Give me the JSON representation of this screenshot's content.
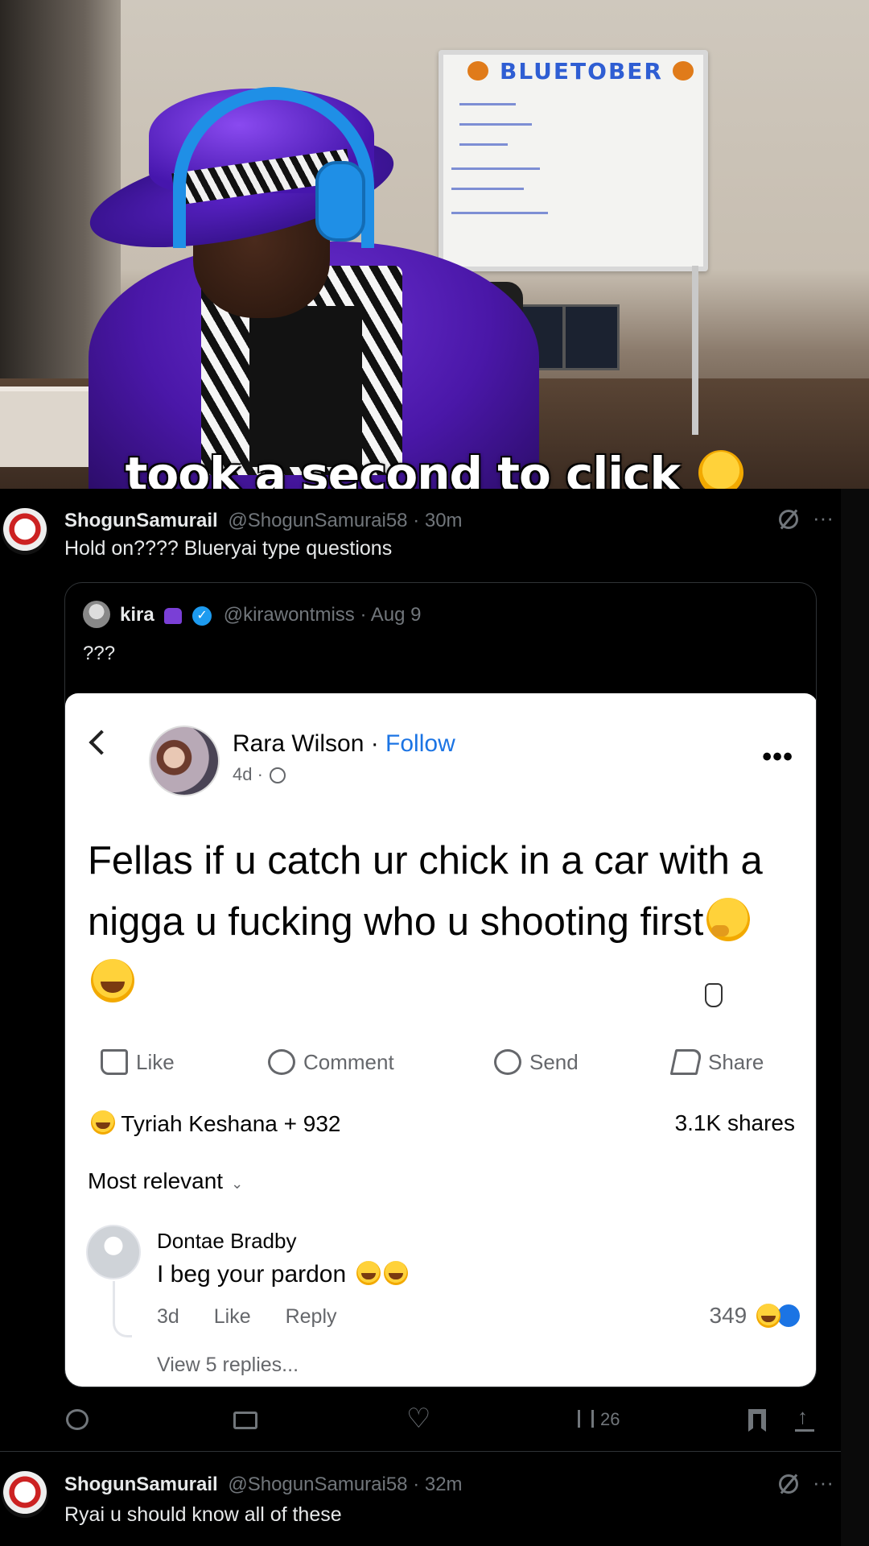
{
  "stream": {
    "caption": "took a second to click",
    "caption_emoji": "loudly-crying-face",
    "whiteboard_title": "BLUETOBER"
  },
  "tweet1": {
    "name": "ShogunSamurail",
    "handle": "@ShogunSamurai58",
    "time": "30m",
    "text": "Hold on???? Blueryai type questions",
    "more": "···"
  },
  "quote": {
    "name": "kira",
    "handle": "@kirawontmiss",
    "date": "Aug 9",
    "text": "???"
  },
  "fb": {
    "author": "Rara Wilson",
    "separator": " · ",
    "follow": "Follow",
    "time": "4d ·",
    "more": "•••",
    "post_text": "Fellas if u catch ur chick in a car with a nigga u fucking who u shooting first",
    "actions": {
      "like": "Like",
      "comment": "Comment",
      "send": "Send",
      "share": "Share"
    },
    "reactions": "Tyriah Keshana + 932",
    "shares": "3.1K shares",
    "sort": "Most relevant",
    "comment": {
      "name": "Dontae Bradby",
      "text": "I beg your pardon",
      "time": "3d",
      "like": "Like",
      "reply": "Reply",
      "count": "349",
      "view_replies": "View 5 replies..."
    }
  },
  "tweet_actions": {
    "views": "26"
  },
  "tweet2": {
    "name": "ShogunSamurail",
    "handle": "@ShogunSamurai58",
    "time": "32m",
    "text": "Ryai u should know all of these",
    "more": "···"
  },
  "colors": {
    "twitter_bg": "#000000",
    "twitter_muted": "#71767b",
    "twitter_blue": "#1d9bf0",
    "fb_blue": "#1b74e4",
    "hat_purple": "#5a22c8",
    "headphone_blue": "#1f8fe6"
  }
}
